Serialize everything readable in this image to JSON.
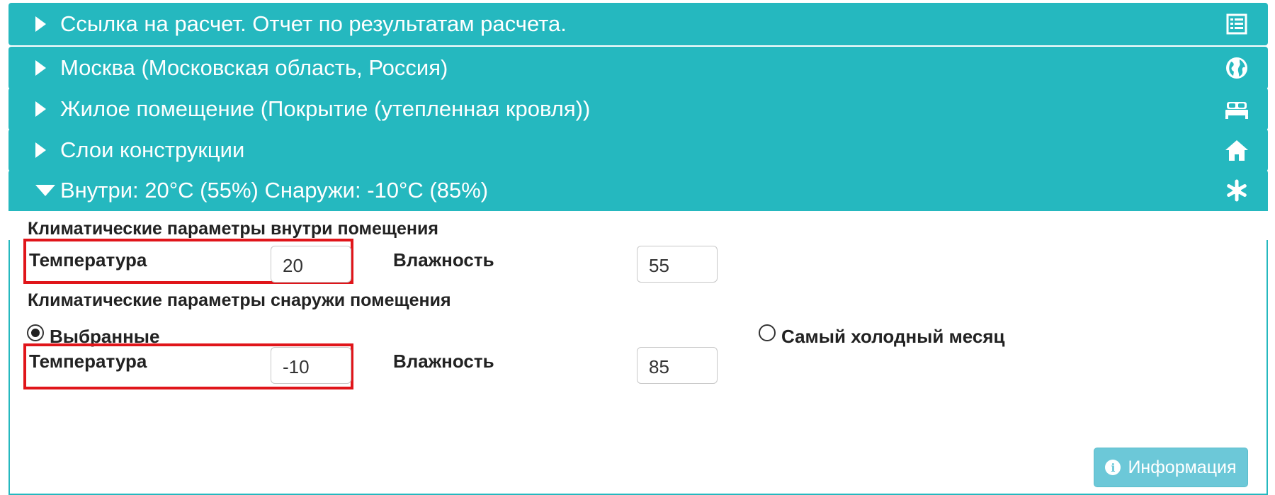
{
  "panels": [
    {
      "title": "Ссылка на расчет. Отчет по результатам расчета.",
      "icon": "list-icon",
      "expanded": false
    },
    {
      "title": "Москва (Московская область, Россия)",
      "icon": "globe-icon",
      "expanded": false
    },
    {
      "title": "Жилое помещение (Покрытие (утепленная кровля))",
      "icon": "bed-icon",
      "expanded": false
    },
    {
      "title": "Слои конструкции",
      "icon": "home-icon",
      "expanded": false
    },
    {
      "title": "Внутри: 20°C (55%) Снаружи: -10°C (85%)",
      "icon": "snowflake-icon",
      "expanded": true
    }
  ],
  "climate": {
    "inside": {
      "heading": "Климатические параметры внутри помещения",
      "temperature_label": "Температура",
      "temperature_value": "20",
      "humidity_label": "Влажность",
      "humidity_value": "55"
    },
    "outside": {
      "heading": "Климатические параметры снаружи помещения",
      "option_selected": "Выбранные",
      "option_coldest": "Самый холодный месяц",
      "temperature_label": "Температура",
      "temperature_value": "-10",
      "humidity_label": "Влажность",
      "humidity_value": "85"
    }
  },
  "info_button": {
    "label": "Информация",
    "icon": "info-icon"
  },
  "colors": {
    "accent": "#25b8bf",
    "highlight": "#e0151a",
    "button": "#6cc8d8"
  }
}
